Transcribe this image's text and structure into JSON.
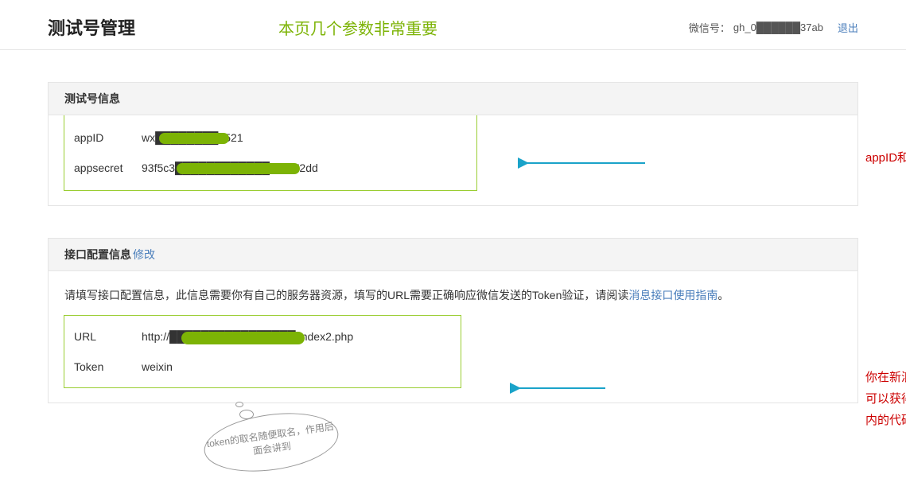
{
  "header": {
    "title": "测试号管理",
    "notice": "本页几个参数非常重要",
    "wechat_label": "微信号：",
    "wechat_value": "gh_0██████37ab",
    "logout": "退出"
  },
  "panel1": {
    "title": "测试号信息",
    "appid_label": "appID",
    "appid_value": "wx████████9521",
    "appsecret_label": "appsecret",
    "appsecret_value": "93f5c3████████████03cc72dd"
  },
  "panel2": {
    "title": "接口配置信息",
    "modify": "修改",
    "desc_prefix": "请填写接口配置信息，此信息需要你有自己的服务器资源，填写的URL需要正确响应微信发送的Token验证，请阅读",
    "desc_link": "消息接口使用指南",
    "desc_suffix": "。",
    "url_label": "URL",
    "url_value": "http://████████████████/index2.php",
    "token_label": "Token",
    "token_value": "weixin"
  },
  "annotations": {
    "a1": "appID和appsecret是自动生成",
    "a2": "你在新浪云SAE上申请一个大小服务器空间后，可以获得一个域名。通过网络可以访问这个服务器内的代码文件。",
    "speech": "token的取名随便取名，作用后面会讲到"
  }
}
